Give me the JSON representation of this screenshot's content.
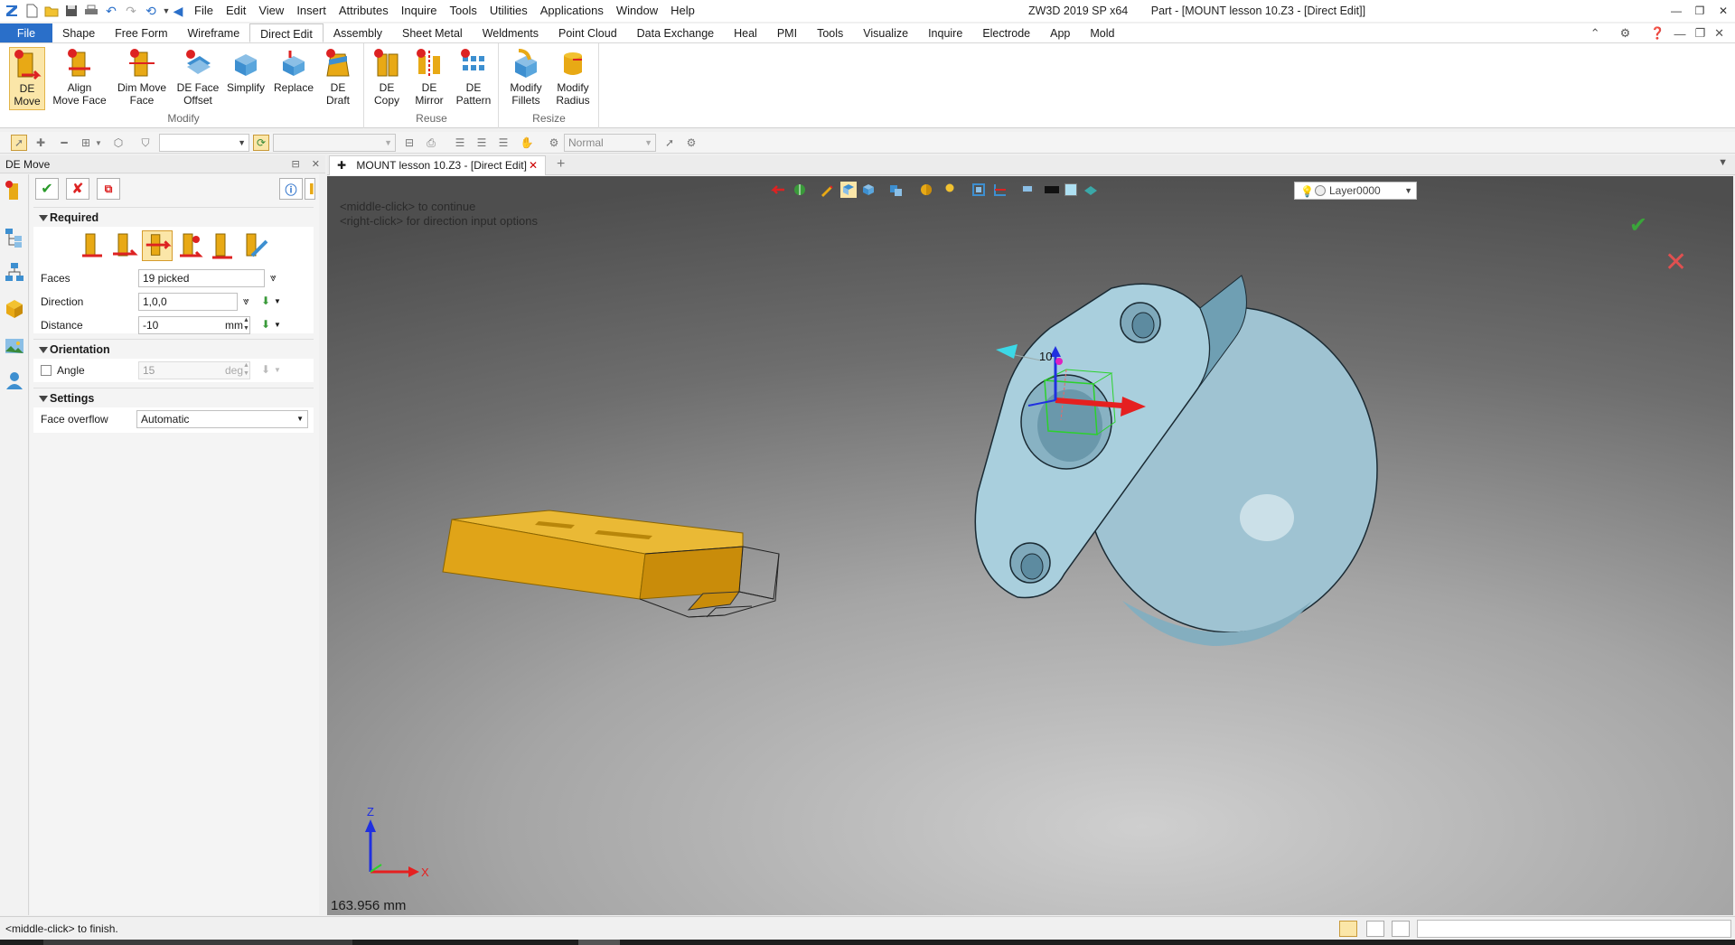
{
  "title_bar": {
    "app_name": "ZW3D 2019 SP x64",
    "document_title": "Part - [MOUNT lesson 10.Z3 - [Direct Edit]]",
    "menu": [
      "File",
      "Edit",
      "View",
      "Insert",
      "Attributes",
      "Inquire",
      "Tools",
      "Utilities",
      "Applications",
      "Window",
      "Help"
    ]
  },
  "ribbon": {
    "tabs": [
      {
        "label": "File"
      },
      {
        "label": "Shape"
      },
      {
        "label": "Free Form"
      },
      {
        "label": "Wireframe"
      },
      {
        "label": "Direct Edit"
      },
      {
        "label": "Assembly"
      },
      {
        "label": "Sheet Metal"
      },
      {
        "label": "Weldments"
      },
      {
        "label": "Point Cloud"
      },
      {
        "label": "Data Exchange"
      },
      {
        "label": "Heal"
      },
      {
        "label": "PMI"
      },
      {
        "label": "Tools"
      },
      {
        "label": "Visualize"
      },
      {
        "label": "Inquire"
      },
      {
        "label": "Electrode"
      },
      {
        "label": "App"
      },
      {
        "label": "Mold"
      }
    ],
    "active_tab": "Direct Edit",
    "groups": [
      {
        "label": "Modify",
        "buttons": [
          {
            "line1": "DE",
            "line2": "Move"
          },
          {
            "line1": "Align",
            "line2": "Move Face"
          },
          {
            "line1": "Dim Move",
            "line2": "Face"
          },
          {
            "line1": "DE Face",
            "line2": "Offset"
          },
          {
            "line1": "Simplify",
            "line2": ""
          },
          {
            "line1": "Replace",
            "line2": ""
          },
          {
            "line1": "DE",
            "line2": "Draft"
          }
        ]
      },
      {
        "label": "Reuse",
        "buttons": [
          {
            "line1": "DE",
            "line2": "Copy"
          },
          {
            "line1": "DE",
            "line2": "Mirror"
          },
          {
            "line1": "DE",
            "line2": "Pattern"
          }
        ]
      },
      {
        "label": "Resize",
        "buttons": [
          {
            "line1": "Modify",
            "line2": "Fillets"
          },
          {
            "line1": "Modify",
            "line2": "Radius"
          }
        ]
      }
    ]
  },
  "toolbar": {
    "render_mode": "Normal"
  },
  "left_panel": {
    "header": "DE Move",
    "required": {
      "title": "Required",
      "faces_label": "Faces",
      "faces_value": "19 picked",
      "direction_label": "Direction",
      "direction_value": "1,0,0",
      "distance_label": "Distance",
      "distance_value": "-10",
      "distance_unit": "mm"
    },
    "orientation": {
      "title": "Orientation",
      "angle_label": "Angle",
      "angle_value": "15",
      "angle_unit": "deg",
      "angle_checked": false
    },
    "settings": {
      "title": "Settings",
      "overflow_label": "Face overflow",
      "overflow_value": "Automatic"
    }
  },
  "document": {
    "tab_label": "MOUNT lesson 10.Z3 - [Direct Edit]"
  },
  "viewport": {
    "hint_line1": "<middle-click> to continue",
    "hint_line2": "<right-click> for direction input options",
    "layer": "Layer0000",
    "dimension_label": "10",
    "axis_z": "Z",
    "axis_x": "X",
    "readout": "163.956 mm"
  },
  "status": {
    "message": "<middle-click> to finish."
  },
  "colors": {
    "file_tab": "#2a6fc9",
    "part_blue": "#9fc3d2",
    "selected_faces": "#e8a915",
    "move_arrow": "#e52020",
    "highlight": "#fbe6a8"
  }
}
